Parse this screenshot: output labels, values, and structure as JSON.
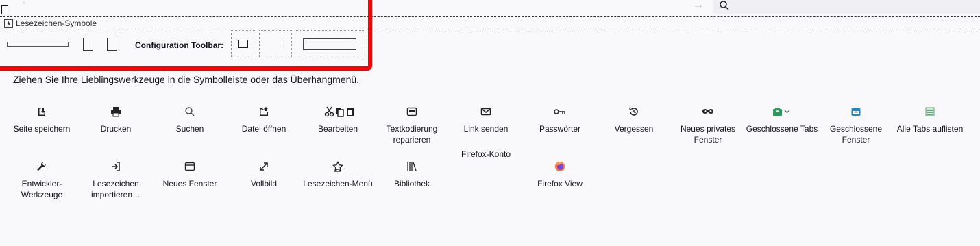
{
  "bookmarks_toolbar": {
    "label": "Lesezeichen-Symbole",
    "icon": "star-icon"
  },
  "config_toolbar": {
    "label": "Configuration Toolbar:"
  },
  "hint": "Ziehen Sie Ihre Lieblingswerkzeuge in die Symbolleiste oder das Überhangmenü.",
  "tools": [
    {
      "label": "Seite speichern",
      "icon": "save-page-icon"
    },
    {
      "label": "Drucken",
      "icon": "printer-icon"
    },
    {
      "label": "Suchen",
      "icon": "search-icon"
    },
    {
      "label": "Datei öffnen",
      "icon": "open-file-icon"
    },
    {
      "label": "Bearbeiten",
      "icon": "cut-copy-paste-icon"
    },
    {
      "label": "Textkodierung reparieren",
      "icon": "text-encoding-icon"
    },
    {
      "label": "Link senden",
      "icon": "mail-icon"
    },
    {
      "label": "Passwörter",
      "icon": "key-icon"
    },
    {
      "label": "Vergessen",
      "icon": "history-forget-icon"
    },
    {
      "label": "Neues privates Fenster",
      "icon": "private-mask-icon"
    },
    {
      "label": "Geschlossene Tabs",
      "icon": "closed-tabs-icon"
    },
    {
      "label": "Geschlossene Fenster",
      "icon": "closed-windows-icon"
    },
    {
      "label": "Alle Tabs auflisten",
      "icon": "list-tabs-icon"
    },
    {
      "label": "Entwickler-Werkzeuge",
      "icon": "wrench-icon"
    },
    {
      "label": "Lesezeichen importieren…",
      "icon": "import-icon"
    },
    {
      "label": "Neues Fenster",
      "icon": "new-window-icon"
    },
    {
      "label": "Vollbild",
      "icon": "fullscreen-icon"
    },
    {
      "label": "Lesezeichen-Menü",
      "icon": "bookmark-menu-icon"
    },
    {
      "label": "Bibliothek",
      "icon": "library-icon"
    },
    {
      "label": "Firefox-Konto",
      "icon": "account-icon"
    },
    {
      "label": "Firefox View",
      "icon": "firefox-view-icon"
    }
  ],
  "colors": {
    "accent_red": "#ff0000",
    "green": "#2ac3a2",
    "teal": "#0a84ff"
  }
}
